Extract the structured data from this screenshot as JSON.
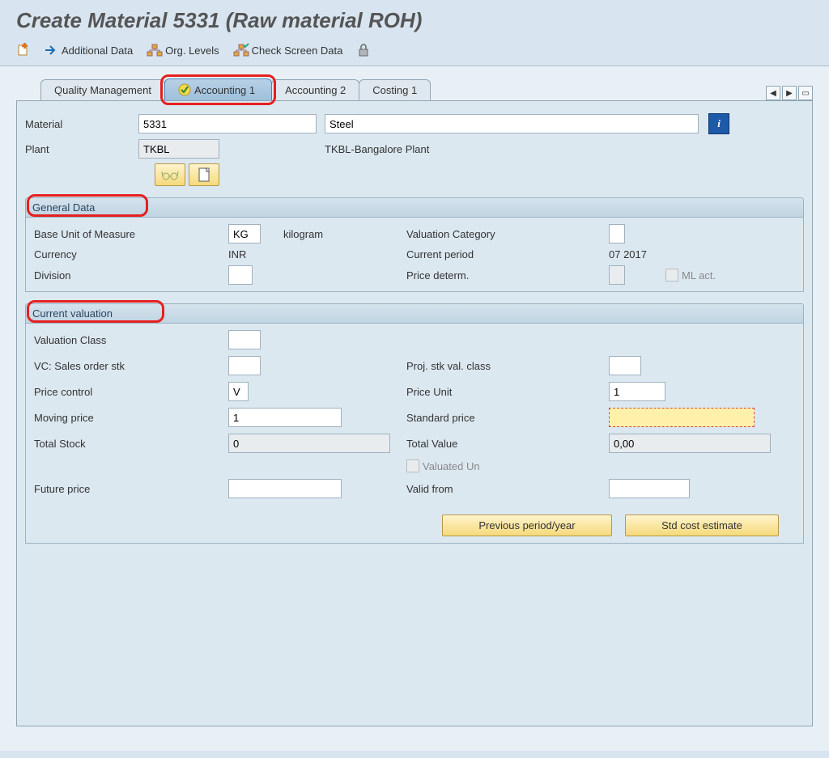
{
  "title": "Create Material 5331 (Raw material ROH)",
  "toolbar": {
    "additional_data": "Additional Data",
    "org_levels": "Org. Levels",
    "check_screen_data": "Check Screen Data"
  },
  "tabs": {
    "t1": "Quality Management",
    "t2": "Accounting 1",
    "t3": "Accounting 2",
    "t4": "Costing 1"
  },
  "header_fields": {
    "material_lbl": "Material",
    "material_val": "5331",
    "material_desc": "Steel",
    "plant_lbl": "Plant",
    "plant_val": "TKBL",
    "plant_desc": "TKBL-Bangalore Plant"
  },
  "general_data": {
    "title": "General Data",
    "buom_lbl": "Base Unit of Measure",
    "buom_val": "KG",
    "buom_desc": "kilogram",
    "valcat_lbl": "Valuation Category",
    "valcat_val": "",
    "currency_lbl": "Currency",
    "currency_val": "INR",
    "curperiod_lbl": "Current period",
    "curperiod_val": "07 2017",
    "division_lbl": "Division",
    "division_val": "",
    "pricedet_lbl": "Price determ.",
    "pricedet_val": "",
    "mlact_lbl": "ML act."
  },
  "current_valuation": {
    "title": "Current valuation",
    "valclass_lbl": "Valuation Class",
    "valclass_val": "",
    "vcsales_lbl": "VC: Sales order stk",
    "vcsales_val": "",
    "projstk_lbl": "Proj. stk val. class",
    "projstk_val": "",
    "pricecontrol_lbl": "Price control",
    "pricecontrol_val": "V",
    "priceunit_lbl": "Price Unit",
    "priceunit_val": "1",
    "movingprice_lbl": "Moving price",
    "movingprice_val": "1",
    "stdprice_lbl": "Standard price",
    "stdprice_val": "",
    "totalstock_lbl": "Total Stock",
    "totalstock_val": "0",
    "totalvalue_lbl": "Total Value",
    "totalvalue_val": "0,00",
    "valuatedun_lbl": "Valuated Un",
    "futureprice_lbl": "Future price",
    "futureprice_val": "",
    "validfrom_lbl": "Valid from",
    "validfrom_val": ""
  },
  "buttons": {
    "prev": "Previous period/year",
    "std": "Std cost estimate"
  }
}
